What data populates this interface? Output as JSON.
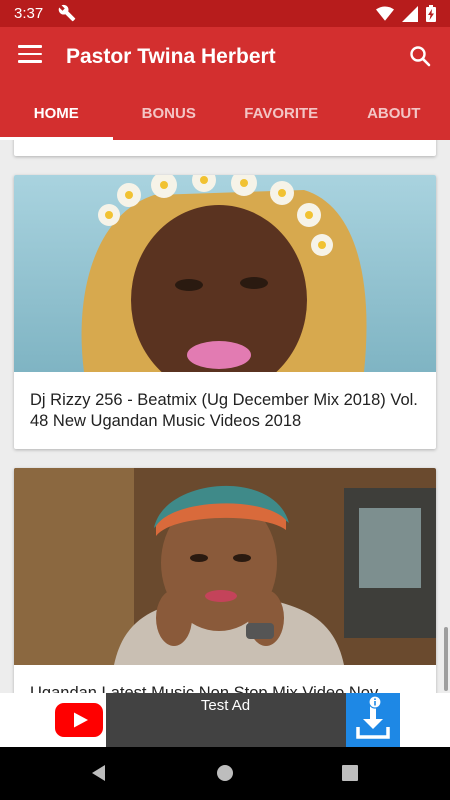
{
  "status_bar": {
    "time": "3:37"
  },
  "app_bar": {
    "title": "Pastor Twina Herbert"
  },
  "tabs": [
    {
      "label": "HOME",
      "active": true
    },
    {
      "label": "BONUS",
      "active": false
    },
    {
      "label": "FAVORITE",
      "active": false
    },
    {
      "label": "ABOUT",
      "active": false
    }
  ],
  "feed": {
    "items": [
      {
        "title": "Dj Rizzy 256 -  Beatmix (Ug December Mix 2018) Vol. 48 New Ugandan Music Videos 2018"
      },
      {
        "title": "Ugandan Latest Music Non Stop Mix Video Nov"
      }
    ]
  },
  "ad": {
    "label": "Test Ad"
  },
  "colors": {
    "primary": "#d32f2f",
    "status_bar": "#b71c1c",
    "ad_accent": "#1e88e5"
  }
}
